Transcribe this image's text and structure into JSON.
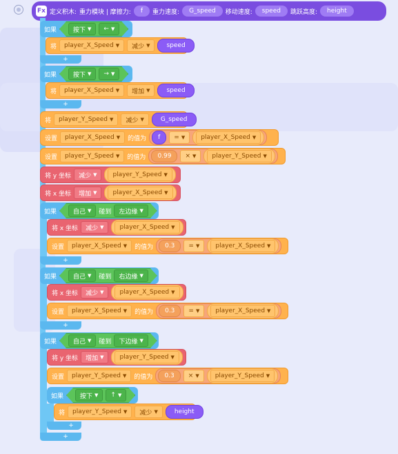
{
  "hat": {
    "icon": "fx-icon",
    "define_label": "定义积木:",
    "title": "重力模块 | 摩擦力:",
    "gravity_label": "重力速度:",
    "move_label": "移动速度:",
    "jump_label": "跳跃高度:",
    "param_friction": "f",
    "param_gravity": "G_speed",
    "param_move": "speed",
    "param_jump": "height"
  },
  "labels": {
    "if": "如果",
    "set_var": "将",
    "set_value": "设置",
    "value_to": "的值为",
    "touch": "碰到",
    "set_x": "将 x 坐标",
    "set_y": "将 y 坐标",
    "plus": "+"
  },
  "options": {
    "pressed": "按下",
    "left_arrow": "←",
    "right_arrow": "→",
    "up_arrow": "↑",
    "decrease": "减少",
    "increase": "增加",
    "self": "自己",
    "left_edge": "左边缘",
    "right_edge": "右边缘",
    "bottom_edge": "下边缘",
    "mul": "×",
    "eq": "="
  },
  "vars": {
    "x_speed": "player_X_Speed",
    "y_speed": "player_Y_Speed",
    "speed": "speed",
    "g_speed": "G_speed",
    "f": "f",
    "height": "height"
  },
  "numbers": {
    "friction": "0.99",
    "bounce_a": "0.3",
    "bounce_b": "0.3",
    "bounce_c": "0.3"
  },
  "icons": {
    "dropdown": "▼"
  }
}
